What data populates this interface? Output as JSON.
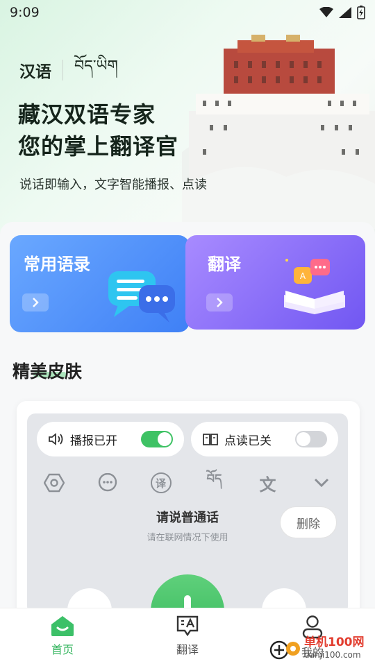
{
  "status": {
    "time": "9:09"
  },
  "hero": {
    "lang_zh": "汉语",
    "lang_bo": "བོད་ཡིག",
    "title_line1": "藏汉双语专家",
    "title_line2": "您的掌上翻译官",
    "subtitle": "说话即输入，文字智能播报、点读"
  },
  "cards": {
    "phrases_label": "常用语录",
    "translate_label": "翻译"
  },
  "skins": {
    "section_title": "精美皮肤",
    "broadcast_label": "播报已开",
    "broadcast_on": true,
    "read_label": "点读已关",
    "read_on": false,
    "tools": [
      "hexagon-icon",
      "chat-icon",
      "translate-char-icon",
      "tibetan-char-icon",
      "wen-char-icon",
      "chevron-down-icon"
    ],
    "tool_char_yi": "译",
    "tool_char_bo": "བོད",
    "tool_char_wen": "文",
    "prompt_main": "请说普通话",
    "prompt_sub": "请在联网情况下使用",
    "delete_label": "删除"
  },
  "tabbar": {
    "home": "首页",
    "translate": "翻译",
    "mine": "我的"
  },
  "watermark": {
    "line1": "单机100网",
    "line2": "danji100.com"
  },
  "colors": {
    "accent": "#2fb35a",
    "phrase_card": "#4a8cf8",
    "translate_card": "#8a6cf7"
  }
}
